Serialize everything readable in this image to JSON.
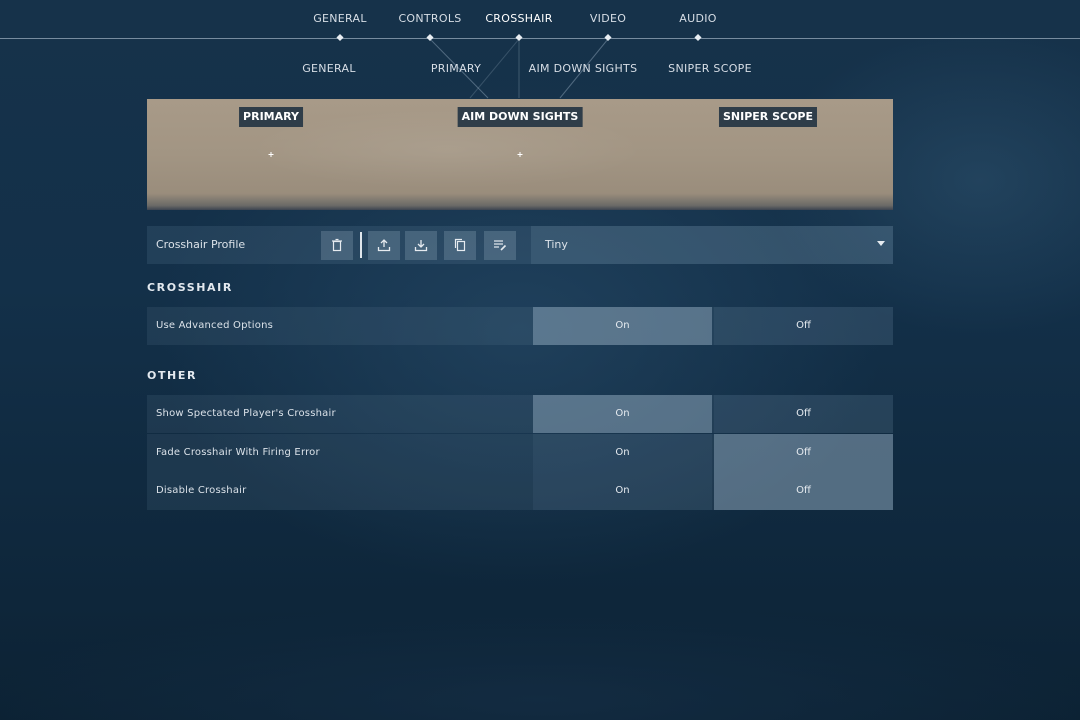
{
  "top_nav": {
    "tabs": [
      {
        "label": "GENERAL"
      },
      {
        "label": "CONTROLS"
      },
      {
        "label": "CROSSHAIR"
      },
      {
        "label": "VIDEO"
      },
      {
        "label": "AUDIO"
      }
    ],
    "active": "CROSSHAIR"
  },
  "sub_nav": {
    "tabs": [
      {
        "label": "GENERAL"
      },
      {
        "label": "PRIMARY"
      },
      {
        "label": "AIM DOWN SIGHTS"
      },
      {
        "label": "SNIPER SCOPE"
      }
    ]
  },
  "preview": {
    "labels": [
      "PRIMARY",
      "AIM DOWN SIGHTS",
      "SNIPER SCOPE"
    ]
  },
  "profile": {
    "title": "Crosshair Profile",
    "icons": [
      "trash-icon",
      "upload-icon",
      "download-icon",
      "copy-icon",
      "edit-list-icon"
    ],
    "selected": "Tiny"
  },
  "sections": {
    "crosshair_title": "CROSSHAIR",
    "other_title": "OTHER"
  },
  "settings": [
    {
      "label": "Use Advanced Options",
      "on": "On",
      "off": "Off",
      "value": "On"
    },
    {
      "label": "Show Spectated Player's Crosshair",
      "on": "On",
      "off": "Off",
      "value": "On"
    },
    {
      "label": "Fade Crosshair With Firing Error",
      "on": "On",
      "off": "Off",
      "value": "Off"
    },
    {
      "label": "Disable Crosshair",
      "on": "On",
      "off": "Off",
      "value": "Off"
    }
  ]
}
